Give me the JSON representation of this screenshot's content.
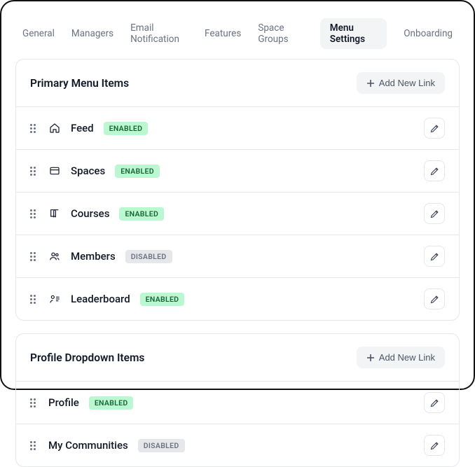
{
  "tabs": [
    {
      "label": "General",
      "active": false
    },
    {
      "label": "Managers",
      "active": false
    },
    {
      "label": "Email Notification",
      "active": false
    },
    {
      "label": "Features",
      "active": false
    },
    {
      "label": "Space Groups",
      "active": false
    },
    {
      "label": "Menu Settings",
      "active": true
    },
    {
      "label": "Onboarding",
      "active": false
    }
  ],
  "sections": [
    {
      "title": "Primary Menu Items",
      "addLabel": "Add New Link",
      "items": [
        {
          "icon": "home",
          "label": "Feed",
          "status": "ENABLED"
        },
        {
          "icon": "grid",
          "label": "Spaces",
          "status": "ENABLED"
        },
        {
          "icon": "book",
          "label": "Courses",
          "status": "ENABLED"
        },
        {
          "icon": "users",
          "label": "Members",
          "status": "DISABLED"
        },
        {
          "icon": "leaderboard",
          "label": "Leaderboard",
          "status": "ENABLED"
        }
      ]
    },
    {
      "title": "Profile Dropdown Items",
      "addLabel": "Add New Link",
      "items": [
        {
          "icon": "none",
          "label": "Profile",
          "status": "ENABLED"
        },
        {
          "icon": "none",
          "label": "My Communities",
          "status": "DISABLED"
        }
      ]
    }
  ]
}
